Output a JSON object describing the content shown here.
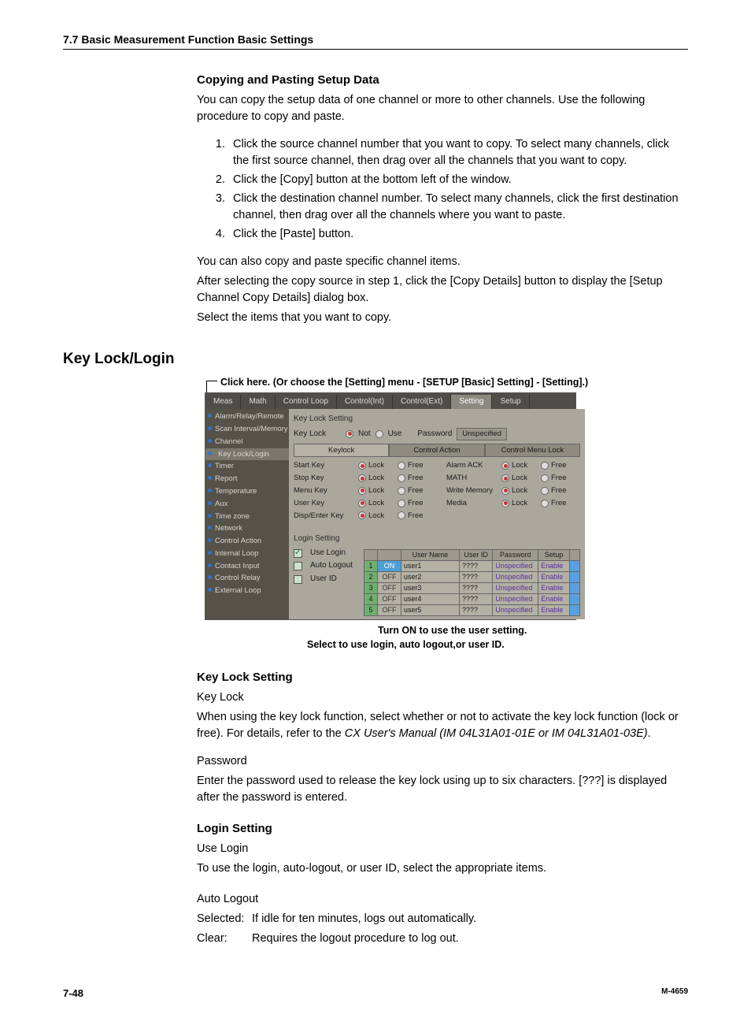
{
  "header": "7.7  Basic Measurement Function Basic Settings",
  "sec1": {
    "title": "Copying and Pasting Setup Data",
    "intro": "You can copy the setup data of one channel or more to other channels.  Use the following procedure to copy and paste.",
    "steps": [
      "Click the source channel number that you want to copy.  To select many channels, click the first source channel, then drag over all the channels that you want to copy.",
      "Click the [Copy] button at the bottom left of the window.",
      "Click the destination channel number.  To select many channels, click the first destination channel, then drag over all the channels where you want to paste.",
      "Click the [Paste] button."
    ],
    "after1": "You can also copy and paste specific channel items.",
    "after2": "After selecting the copy source in step 1, click the [Copy Details] button to display the [Setup Channel Copy Details] dialog box.",
    "after3": "Select the items that you want to copy."
  },
  "sec2": {
    "title": "Key Lock/Login",
    "annot_top": "Click here. (Or choose the [Setting] menu - [SETUP [Basic] Setting] - [Setting].)",
    "annot_b1": "Turn ON to use the user setting.",
    "annot_b2": "Select to use login, auto logout,or user ID."
  },
  "shot": {
    "tabs": [
      "Meas",
      "Math",
      "Control Loop",
      "Control(Int)",
      "Control(Ext)",
      "Setting",
      "Setup"
    ],
    "active_tab": 5,
    "sidebar": [
      "Alarm/Relay/Remote",
      "Scan Interval/Memory",
      "Channel",
      "Key Lock/Login",
      "Timer",
      "Report",
      "Temperature",
      "Aux",
      "Time zone",
      "Network",
      "Control Action",
      "Internal Loop",
      "Contact Input",
      "Control Relay",
      "External Loop"
    ],
    "sidebar_sel": 3,
    "kls_title": "Key Lock Setting",
    "keylock_label": "Key Lock",
    "not_label": "Not",
    "use_label": "Use",
    "password_label": "Password",
    "password_btn": "Unspecified",
    "subtabs": [
      "Keylock",
      "Control Action",
      "Control Menu Lock"
    ],
    "lock": "Lock",
    "free": "Free",
    "kl_rows_left": [
      "Start Key",
      "Stop Key",
      "Menu Key",
      "User Key",
      "Disp/Enter Key"
    ],
    "kl_rows_right": [
      "Alarm ACK",
      "MATH",
      "Write Memory",
      "Media"
    ],
    "login_title": "Login Setting",
    "use_login": "Use Login",
    "auto_logout": "Auto Logout",
    "user_id": "User ID",
    "tbl_headers": [
      "",
      "",
      "User Name",
      "User ID",
      "Password",
      "Setup",
      ""
    ],
    "tbl_rows": [
      {
        "n": "1",
        "on": "ON",
        "name": "user1",
        "id": "????",
        "pw": "Unspecified",
        "setup": "Enable"
      },
      {
        "n": "2",
        "on": "OFF",
        "name": "user2",
        "id": "????",
        "pw": "Unspecified",
        "setup": "Enable"
      },
      {
        "n": "3",
        "on": "OFF",
        "name": "user3",
        "id": "????",
        "pw": "Unspecified",
        "setup": "Enable"
      },
      {
        "n": "4",
        "on": "OFF",
        "name": "user4",
        "id": "????",
        "pw": "Unspecified",
        "setup": "Enable"
      },
      {
        "n": "5",
        "on": "OFF",
        "name": "user5",
        "id": "????",
        "pw": "Unspecified",
        "setup": "Enable"
      }
    ]
  },
  "sec3": {
    "title": "Key Lock Setting",
    "kl_h": "Key Lock",
    "kl_p": "When using the key lock function, select whether or not to activate the key lock function (lock or free).  For details, refer to the ",
    "kl_em": "CX User's Manual (IM 04L31A01-01E or IM 04L31A01-03E)",
    "pw_h": "Password",
    "pw_p": "Enter the password used to release the key lock using up to six characters.  [???] is displayed after the password is entered."
  },
  "sec4": {
    "title": "Login Setting",
    "ul_h": "Use Login",
    "ul_p": "To use the login, auto-logout, or user ID, select the appropriate items.",
    "al_h": "Auto Logout",
    "al_p1a": "Selected:",
    "al_p1b": "If idle for ten minutes, logs out automatically.",
    "al_p2a": "Clear:",
    "al_p2b": "Requires the logout procedure to log out."
  },
  "footer": {
    "page": "7-48",
    "mn": "M-4659"
  }
}
